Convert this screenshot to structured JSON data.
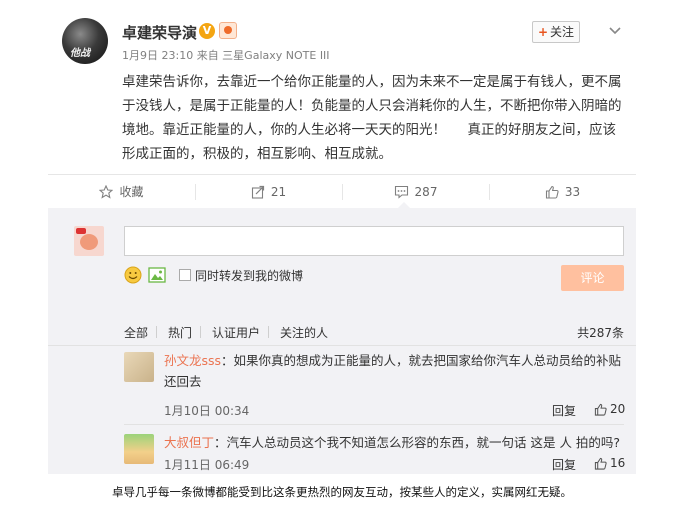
{
  "post": {
    "avatar_text": "他战",
    "username": "卓建荣导演",
    "vbadge": "V",
    "meta": "1月9日 23:10 来自 三星Galaxy NOTE III",
    "follow_label": "关注",
    "follow_plus": "+",
    "text": "卓建荣告诉你，去靠近一个给你正能量的人，因为未来不一定是属于有钱人，更不属于没钱人，是属于正能量的人！负能量的人只会消耗你的人生，不断把你带入阴暗的境地。靠近正能量的人，你的人生必将一天天的阳光！     真正的好朋友之间，应该形成正面的，积极的，相互影响、相互成就。"
  },
  "actions": {
    "favorite": "收藏",
    "repost_count": "21",
    "comment_count": "287",
    "like_count": "33"
  },
  "comment_box": {
    "repost_label": "同时转发到我的微博",
    "submit_label": "评论"
  },
  "filters": {
    "all": "全部",
    "hot": "热门",
    "verified": "认证用户",
    "following": "关注的人",
    "total": "共287条"
  },
  "comments": [
    {
      "user": "孙文龙sss",
      "text": "：如果你真的想成为正能量的人，就去把国家给你汽车人总动员给的补贴还回去",
      "time": "1月10日 00:34",
      "reply": "回复",
      "likes": "20"
    },
    {
      "user": "大叔但丁",
      "text": "：汽车人总动员这个我不知道怎么形容的东西，就一句话 这是  人  拍的吗?",
      "time": "1月11日 06:49",
      "reply": "回复",
      "likes": "16"
    }
  ],
  "caption": "卓导几乎每一条微博都能受到比这条更热烈的网友互动，按某些人的定义，实属网红无疑。",
  "colors": {
    "username_link": "#eb7350",
    "submit_button": "#ffc09f",
    "vbadge": "#f4a512"
  }
}
